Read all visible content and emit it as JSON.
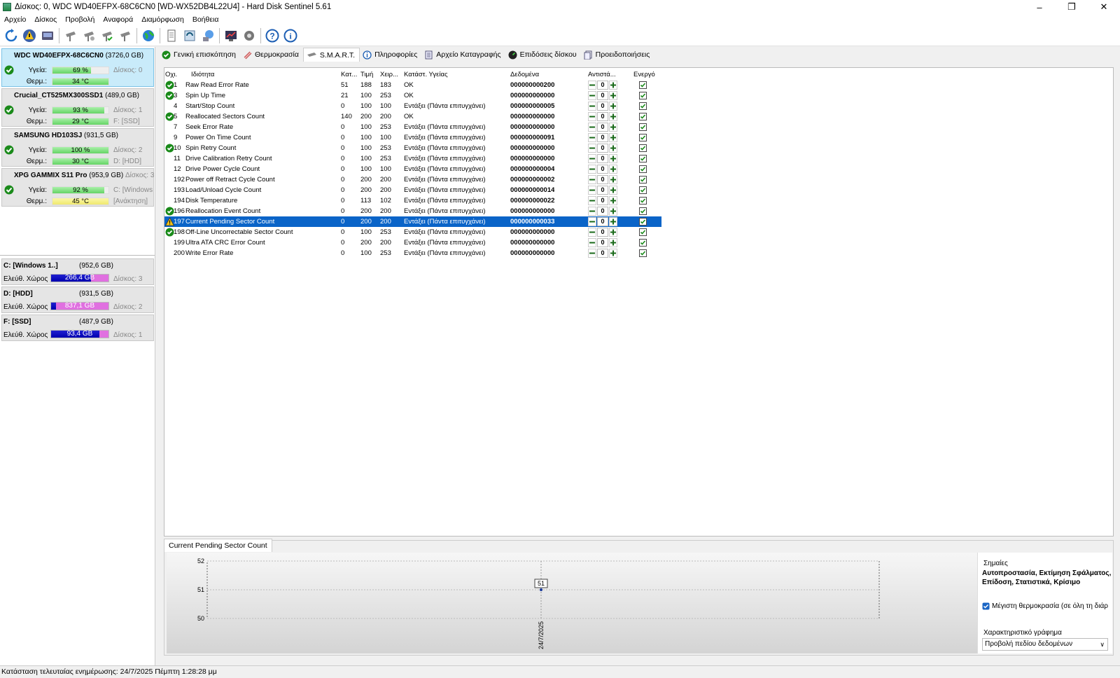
{
  "window": {
    "title": "Δίσκος: 0, WDC WD40EFPX-68C6CN0 [WD-WX52DB4L22U4]  -  Hard Disk Sentinel 5.61"
  },
  "menu": [
    "Αρχείο",
    "Δίσκος",
    "Προβολή",
    "Αναφορά",
    "Διαμόρφωση",
    "Βοήθεια"
  ],
  "toolbar_icons": [
    "refresh-icon",
    "warning-icon",
    "report-icon",
    "disk-tool-icon",
    "disk-test-icon",
    "disk-ok-icon",
    "disk-check-icon",
    "globe-icon",
    "document-icon",
    "sync-icon",
    "network-icon",
    "chart-icon",
    "settings-icon",
    "help-icon",
    "info-icon"
  ],
  "disks": [
    {
      "name": "WDC WD40EFPX-68C6CN0",
      "size": "(3726,0 GB)",
      "health_label": "Υγεία:",
      "health": "69 %",
      "health_pct": 69,
      "temp_label": "Θερμ.:",
      "temp": "34 °C",
      "temp_pct": 100,
      "temp_color": "green",
      "side1": "Δίσκος: 0",
      "side2": ""
    },
    {
      "name": "Crucial_CT525MX300SSD1",
      "size": "(489,0 GB)",
      "health_label": "Υγεία:",
      "health": "93 %",
      "health_pct": 93,
      "temp_label": "Θερμ.:",
      "temp": "29 °C",
      "temp_pct": 100,
      "temp_color": "green",
      "side1": "Δίσκος: 1",
      "side2": "F: [SSD]"
    },
    {
      "name": "SAMSUNG HD103SJ",
      "size": "(931,5 GB)",
      "health_label": "Υγεία:",
      "health": "100 %",
      "health_pct": 100,
      "temp_label": "Θερμ.:",
      "temp": "30 °C",
      "temp_pct": 100,
      "temp_color": "green",
      "side1": "Δίσκος: 2",
      "side2": "D: [HDD]"
    },
    {
      "name": "XPG GAMMIX S11 Pro",
      "size": "(953,9 GB)",
      "side0": "Δίσκος: 3",
      "health_label": "Υγεία:",
      "health": "92 %",
      "health_pct": 92,
      "temp_label": "Θερμ.:",
      "temp": "45 °C",
      "temp_pct": 100,
      "temp_color": "yellow",
      "side1": "C: [Windows",
      "side2": "[Ανάκτηση]"
    }
  ],
  "volumes": [
    {
      "name": "C: [Windows 1..]",
      "size": "(952,6 GB)",
      "label": "Ελεύθ. Χώρος",
      "free": "266,4 GB",
      "free_pct": 28,
      "disk": "Δίσκος: 3"
    },
    {
      "name": "D: [HDD]",
      "size": "(931,5 GB)",
      "label": "Ελεύθ. Χώρος",
      "free": "837,1 GB",
      "free_pct": 0,
      "disk": "Δίσκος: 2"
    },
    {
      "name": "F: [SSD]",
      "size": "(487,9 GB)",
      "label": "Ελεύθ. Χώρος",
      "free": "93,4 GB",
      "free_pct": 81,
      "disk": "Δίσκος: 1"
    }
  ],
  "tabs": [
    {
      "label": "Γενική επισκόπηση",
      "icon": "check-icon",
      "active": false
    },
    {
      "label": "Θερμοκρασία",
      "icon": "thermometer-icon",
      "active": false
    },
    {
      "label": "S.M.A.R.T.",
      "icon": "disk-icon",
      "active": true
    },
    {
      "label": "Πληροφορίες",
      "icon": "info-icon",
      "active": false
    },
    {
      "label": "Αρχείο Καταγραφής",
      "icon": "log-icon",
      "active": false
    },
    {
      "label": "Επιδόσεις δίσκου",
      "icon": "performance-icon",
      "active": false
    },
    {
      "label": "Προειδοποιήσεις",
      "icon": "alerts-icon",
      "active": false
    }
  ],
  "smart_headers": {
    "id": "Οχι.",
    "attr": "Ιδιότητα",
    "thr": "Κατ...",
    "val": "Τιμή",
    "wor": "Χειρ...",
    "hs": "Κατάστ. Υγείας",
    "data": "Δεδομένα",
    "adj": "Αντιστά...",
    "en": "Ενεργό"
  },
  "smart_rows": [
    {
      "id": "1",
      "attr": "Raw Read Error Rate",
      "thr": "51",
      "val": "188",
      "wor": "183",
      "hs": "OK",
      "data": "000000000200",
      "adj": "0",
      "status": "ok"
    },
    {
      "id": "3",
      "attr": "Spin Up Time",
      "thr": "21",
      "val": "100",
      "wor": "253",
      "hs": "OK",
      "data": "000000000000",
      "adj": "0",
      "status": "ok"
    },
    {
      "id": "4",
      "attr": "Start/Stop Count",
      "thr": "0",
      "val": "100",
      "wor": "100",
      "hs": "Εντάξει (Πάντα επιτυγχάνει)",
      "data": "000000000005",
      "adj": "0",
      "status": "none"
    },
    {
      "id": "5",
      "attr": "Reallocated Sectors Count",
      "thr": "140",
      "val": "200",
      "wor": "200",
      "hs": "OK",
      "data": "000000000000",
      "adj": "0",
      "status": "ok"
    },
    {
      "id": "7",
      "attr": "Seek Error Rate",
      "thr": "0",
      "val": "100",
      "wor": "253",
      "hs": "Εντάξει (Πάντα επιτυγχάνει)",
      "data": "000000000000",
      "adj": "0",
      "status": "none"
    },
    {
      "id": "9",
      "attr": "Power On Time Count",
      "thr": "0",
      "val": "100",
      "wor": "100",
      "hs": "Εντάξει (Πάντα επιτυγχάνει)",
      "data": "000000000091",
      "adj": "0",
      "status": "none"
    },
    {
      "id": "10",
      "attr": "Spin Retry Count",
      "thr": "0",
      "val": "100",
      "wor": "253",
      "hs": "Εντάξει (Πάντα επιτυγχάνει)",
      "data": "000000000000",
      "adj": "0",
      "status": "ok"
    },
    {
      "id": "11",
      "attr": "Drive Calibration Retry Count",
      "thr": "0",
      "val": "100",
      "wor": "253",
      "hs": "Εντάξει (Πάντα επιτυγχάνει)",
      "data": "000000000000",
      "adj": "0",
      "status": "none"
    },
    {
      "id": "12",
      "attr": "Drive Power Cycle Count",
      "thr": "0",
      "val": "100",
      "wor": "100",
      "hs": "Εντάξει (Πάντα επιτυγχάνει)",
      "data": "000000000004",
      "adj": "0",
      "status": "none"
    },
    {
      "id": "192",
      "attr": "Power off Retract Cycle Count",
      "thr": "0",
      "val": "200",
      "wor": "200",
      "hs": "Εντάξει (Πάντα επιτυγχάνει)",
      "data": "000000000002",
      "adj": "0",
      "status": "none"
    },
    {
      "id": "193",
      "attr": "Load/Unload Cycle Count",
      "thr": "0",
      "val": "200",
      "wor": "200",
      "hs": "Εντάξει (Πάντα επιτυγχάνει)",
      "data": "000000000014",
      "adj": "0",
      "status": "none"
    },
    {
      "id": "194",
      "attr": "Disk Temperature",
      "thr": "0",
      "val": "113",
      "wor": "102",
      "hs": "Εντάξει (Πάντα επιτυγχάνει)",
      "data": "000000000022",
      "adj": "0",
      "status": "none"
    },
    {
      "id": "196",
      "attr": "Reallocation Event Count",
      "thr": "0",
      "val": "200",
      "wor": "200",
      "hs": "Εντάξει (Πάντα επιτυγχάνει)",
      "data": "000000000000",
      "adj": "0",
      "status": "ok"
    },
    {
      "id": "197",
      "attr": "Current Pending Sector Count",
      "thr": "0",
      "val": "200",
      "wor": "200",
      "hs": "Εντάξει (Πάντα επιτυγχάνει)",
      "data": "000000000033",
      "adj": "0",
      "status": "warn",
      "selected": true
    },
    {
      "id": "198",
      "attr": "Off-Line Uncorrectable Sector Count",
      "thr": "0",
      "val": "100",
      "wor": "253",
      "hs": "Εντάξει (Πάντα επιτυγχάνει)",
      "data": "000000000000",
      "adj": "0",
      "status": "ok"
    },
    {
      "id": "199",
      "attr": "Ultra ATA CRC Error Count",
      "thr": "0",
      "val": "200",
      "wor": "200",
      "hs": "Εντάξει (Πάντα επιτυγχάνει)",
      "data": "000000000000",
      "adj": "0",
      "status": "none"
    },
    {
      "id": "200",
      "attr": "Write Error Rate",
      "thr": "0",
      "val": "100",
      "wor": "253",
      "hs": "Εντάξει (Πάντα επιτυγχάνει)",
      "data": "000000000000",
      "adj": "0",
      "status": "none"
    }
  ],
  "bottom_tab": "Current Pending Sector Count",
  "chart_data": {
    "type": "line",
    "x": [
      "24/7/2025"
    ],
    "series": [
      {
        "values": [
          51
        ]
      }
    ],
    "yticks": [
      "52",
      "51",
      "50"
    ],
    "ylim": [
      50,
      52
    ],
    "data_label": "51",
    "grid": true
  },
  "right_panel": {
    "title": "Σημαίες",
    "flags": "Αυτοπροστασία, Εκτίμηση Σφάλματος, Επίδοση, Στατιστικά, Κρίσιμο",
    "checkbox": "Μέγιστη θερμοκρασία (σε όλη τη διάρ",
    "chart_label": "Χαρακτηριστικό γράφημα",
    "select": "Προβολή πεδίου δεδομένων"
  },
  "status": "Κατάσταση τελευταίας ενημέρωσης: 24/7/2025 Πέμπτη 1:28:28 μμ"
}
